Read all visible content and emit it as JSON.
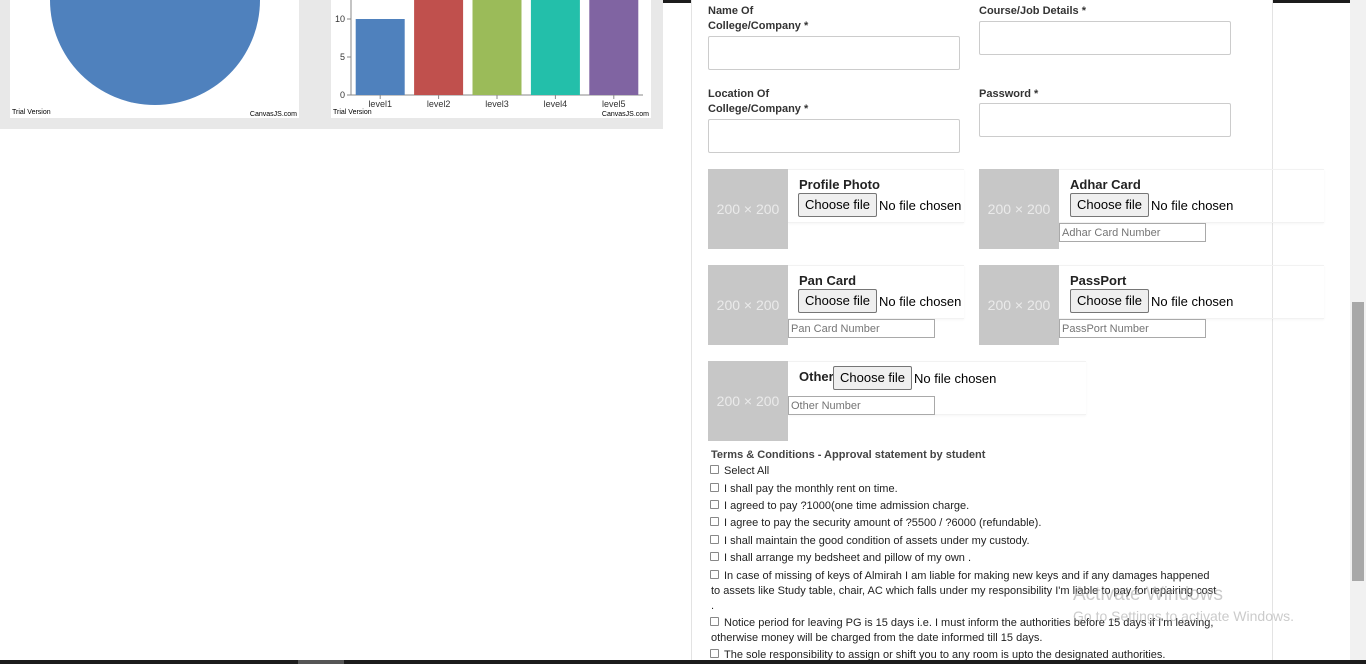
{
  "pie_chart": {
    "watermark_left": "Trial Version",
    "watermark_right": "CanvasJS.com",
    "color": "#4f81bd"
  },
  "bar_chart": {
    "watermark_left": "Trial Version",
    "watermark_right": "CanvasJS.com"
  },
  "chart_data": {
    "type": "bar",
    "categories": [
      "level1",
      "level2",
      "level3",
      "level4",
      "level5"
    ],
    "values": [
      10,
      20,
      20,
      20,
      20
    ],
    "colors": [
      "#4f81bd",
      "#c0504d",
      "#9bbb59",
      "#23bfaa",
      "#8064a2"
    ],
    "yticks": [
      0,
      5,
      10
    ],
    "ylim": [
      0,
      17.5
    ]
  },
  "form": {
    "name_label_line1": "Name Of",
    "name_label_line2": "College/Company *",
    "course_label": "Course/Job Details *",
    "location_label_line1": "Location Of",
    "location_label_line2": "College/Company *",
    "password_label": "Password *"
  },
  "uploads": {
    "placeholder_text": "200 × 200",
    "choose_label": "Choose file",
    "no_file": "No file chosen",
    "profile_photo": {
      "title": "Profile Photo"
    },
    "adhar": {
      "title": "Adhar Card",
      "number_placeholder": "Adhar Card Number"
    },
    "pan": {
      "title": "Pan Card",
      "number_placeholder": "Pan Card Number"
    },
    "passport": {
      "title": "PassPort",
      "number_placeholder": "PassPort Number"
    },
    "other": {
      "title": "Other",
      "number_placeholder": "Other Number"
    }
  },
  "terms": {
    "heading": "Terms & Conditions - Approval statement by student",
    "select_all": "Select All",
    "items": [
      "I shall pay the monthly rent on time.",
      "I agreed to pay ?1000(one time admission charge.",
      "I agree to pay the security amount of ?5500 / ?6000 (refundable).",
      "I shall maintain the good condition of assets under my custody.",
      "I shall arrange my bedsheet and pillow of my own ."
    ],
    "almirah_line1": "In case of missing of keys of Almirah I am liable for making new keys and if any damages happened",
    "almirah_line2": "to assets like Study table, chair, AC which falls under my responsibility I'm liable to pay for repairing cost",
    "almirah_line3": ".",
    "notice_line1": "Notice period for leaving PG is 15 days i.e. I must inform the authorities before 15 days if I'm leaving,",
    "notice_line2": "otherwise money will be charged from the date informed till 15 days.",
    "sole": "The sole responsibility to assign or shift you to any room is upto the designated authorities."
  },
  "watermark": {
    "line1": "Activate Windows",
    "line2": "Go to Settings to activate Windows."
  }
}
